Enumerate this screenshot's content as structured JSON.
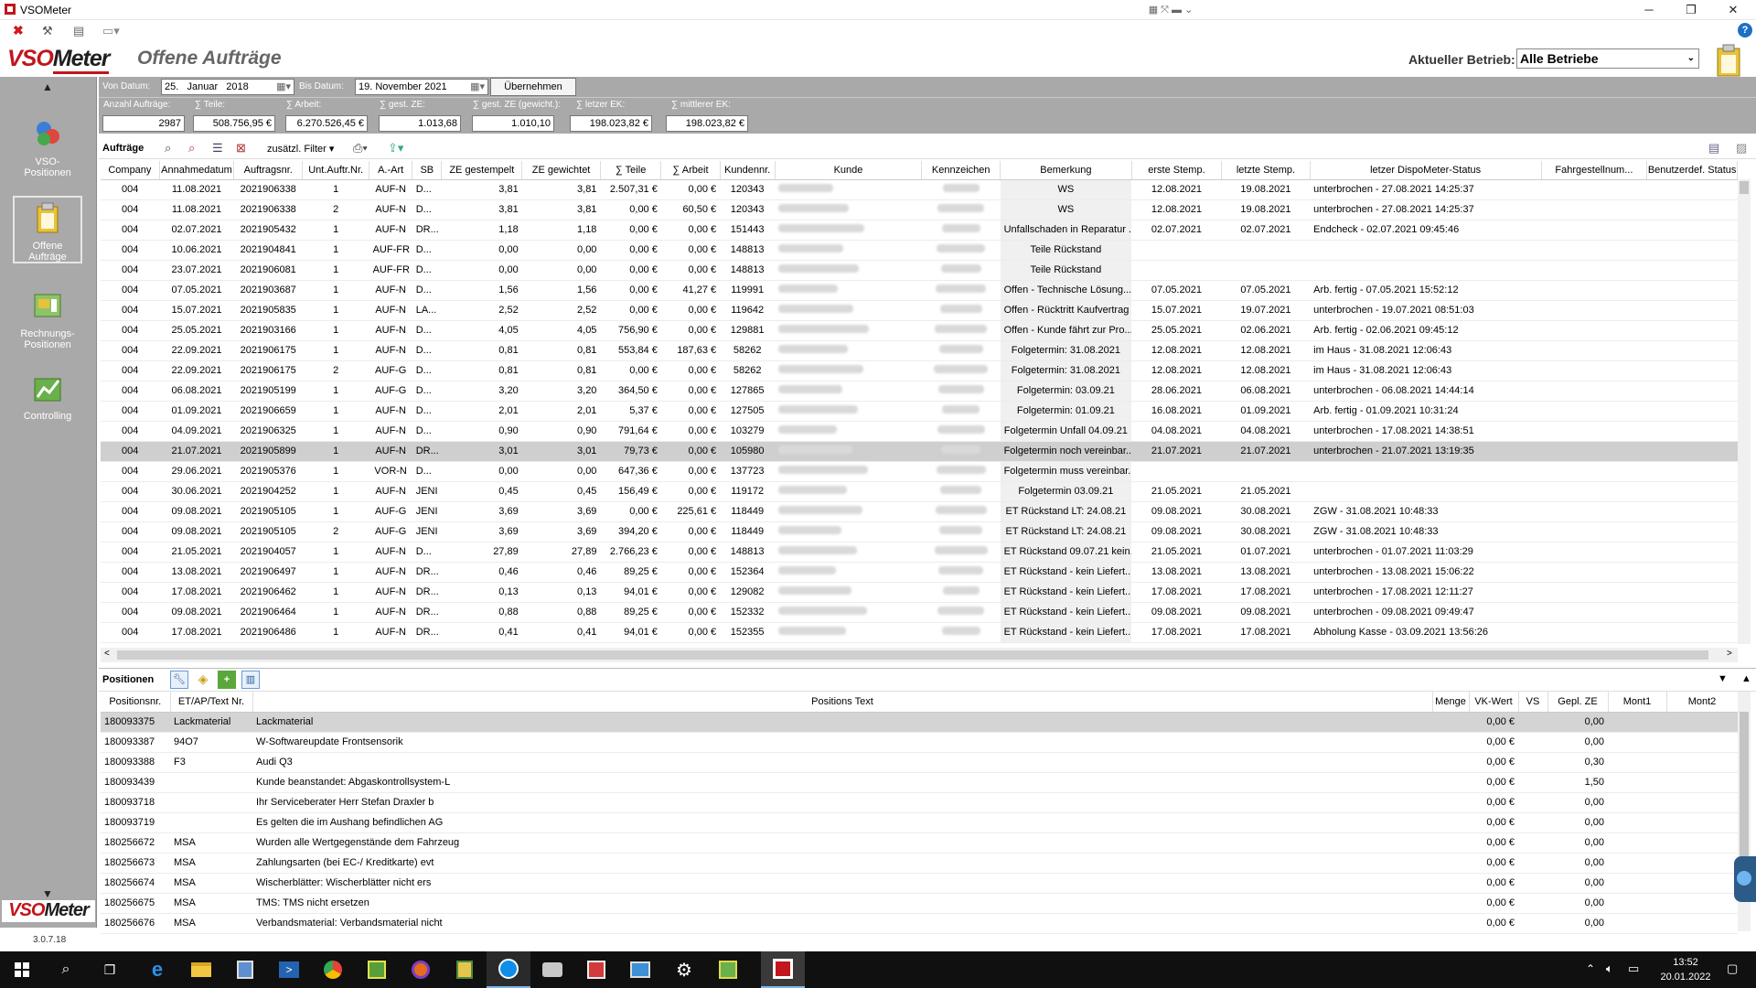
{
  "window": {
    "title": "VSOMeter"
  },
  "header": {
    "logo_left": "VSO",
    "logo_right": "Meter",
    "page_title": "Offene Aufträge",
    "betrieb_label": "Aktueller Betrieb:",
    "betrieb_value": "Alle Betriebe"
  },
  "sidebar": {
    "items": [
      {
        "label": "VSO-Positionen",
        "icon": "vso-positions-icon"
      },
      {
        "label": "Offene Aufträge",
        "icon": "clipboard-icon"
      },
      {
        "label": "Rechnungs-Positionen",
        "icon": "invoice-icon"
      },
      {
        "label": "Controlling",
        "icon": "chart-icon"
      }
    ],
    "footer_logo_left": "VSO",
    "footer_logo_right": "Meter",
    "version": "3.0.7.18"
  },
  "filter": {
    "von_label": "Von Datum:",
    "von_day": "25.",
    "von_month": "Januar",
    "von_year": "2018",
    "bis_label": "Bis Datum:",
    "bis_value": "19. November  2021",
    "apply_label": "Übernehmen"
  },
  "summary": {
    "anzahl_label": "Anzahl Aufträge:",
    "anzahl_value": "2987",
    "teile_label": "∑ Teile:",
    "teile_value": "508.756,95 €",
    "arbeit_label": "∑ Arbeit:",
    "arbeit_value": "6.270.526,45 €",
    "gest_label": "∑ gest. ZE:",
    "gest_value": "1.013,68",
    "gewicht_label": "∑ gest. ZE (gewicht.):",
    "gewicht_value": "1.010,10",
    "letzter_label": "∑ letzer EK:",
    "letzter_value": "198.023,82 €",
    "mittlerer_label": "∑ mittlerer EK:",
    "mittlerer_value": "198.023,82 €"
  },
  "orders_toolbar": {
    "label": "Aufträge",
    "filter_label": "zusätzl. Filter"
  },
  "orders": {
    "columns": [
      "Company",
      "Annahmedatum",
      "Auftragsnr.",
      "Unt.Auftr.Nr.",
      "A.-Art",
      "SB",
      "ZE gestempelt",
      "ZE gewichtet",
      "∑ Teile",
      "∑ Arbeit",
      "Kundennr.",
      "Kunde",
      "Kennzeichen",
      "Bemerkung",
      "erste Stemp.",
      "letzte Stemp.",
      "letzer DispoMeter-Status",
      "Fahrgestellnum...",
      "Benutzerdef. Status"
    ],
    "rows": [
      [
        "004",
        "11.08.2021",
        "2021906338",
        "1",
        "AUF-N",
        "D...",
        "3,81",
        "3,81",
        "2.507,31 €",
        "0,00 €",
        "120343",
        "",
        "",
        "WS",
        "12.08.2021",
        "19.08.2021",
        "unterbrochen - 27.08.2021 14:25:37"
      ],
      [
        "004",
        "11.08.2021",
        "2021906338",
        "2",
        "AUF-N",
        "D...",
        "3,81",
        "3,81",
        "0,00 €",
        "60,50 €",
        "120343",
        "",
        "",
        "WS",
        "12.08.2021",
        "19.08.2021",
        "unterbrochen - 27.08.2021 14:25:37"
      ],
      [
        "004",
        "02.07.2021",
        "2021905432",
        "1",
        "AUF-N",
        "DR...",
        "1,18",
        "1,18",
        "0,00 €",
        "0,00 €",
        "151443",
        "",
        "",
        "Unfallschaden in Reparatur ...",
        "02.07.2021",
        "02.07.2021",
        "Endcheck - 02.07.2021 09:45:46"
      ],
      [
        "004",
        "10.06.2021",
        "2021904841",
        "1",
        "AUF-FR",
        "D...",
        "0,00",
        "0,00",
        "0,00 €",
        "0,00 €",
        "148813",
        "",
        "",
        "Teile Rückstand",
        "",
        "",
        ""
      ],
      [
        "004",
        "23.07.2021",
        "2021906081",
        "1",
        "AUF-FR",
        "D...",
        "0,00",
        "0,00",
        "0,00 €",
        "0,00 €",
        "148813",
        "",
        "",
        "Teile Rückstand",
        "",
        "",
        ""
      ],
      [
        "004",
        "07.05.2021",
        "2021903687",
        "1",
        "AUF-N",
        "D...",
        "1,56",
        "1,56",
        "0,00 €",
        "41,27 €",
        "119991",
        "",
        "",
        "Offen - Technische Lösung...",
        "07.05.2021",
        "07.05.2021",
        "Arb. fertig - 07.05.2021 15:52:12"
      ],
      [
        "004",
        "15.07.2021",
        "2021905835",
        "1",
        "AUF-N",
        "LA...",
        "2,52",
        "2,52",
        "0,00 €",
        "0,00 €",
        "119642",
        "",
        "",
        "Offen - Rücktritt Kaufvertrag",
        "15.07.2021",
        "19.07.2021",
        "unterbrochen - 19.07.2021 08:51:03"
      ],
      [
        "004",
        "25.05.2021",
        "2021903166",
        "1",
        "AUF-N",
        "D...",
        "4,05",
        "4,05",
        "756,90 €",
        "0,00 €",
        "129881",
        "",
        "",
        "Offen - Kunde fährt zur Pro...",
        "25.05.2021",
        "02.06.2021",
        "Arb. fertig - 02.06.2021 09:45:12"
      ],
      [
        "004",
        "22.09.2021",
        "2021906175",
        "1",
        "AUF-N",
        "D...",
        "0,81",
        "0,81",
        "553,84 €",
        "187,63 €",
        "58262",
        "",
        "",
        "Folgetermin: 31.08.2021",
        "12.08.2021",
        "12.08.2021",
        "im Haus - 31.08.2021 12:06:43"
      ],
      [
        "004",
        "22.09.2021",
        "2021906175",
        "2",
        "AUF-G",
        "D...",
        "0,81",
        "0,81",
        "0,00 €",
        "0,00 €",
        "58262",
        "",
        "",
        "Folgetermin: 31.08.2021",
        "12.08.2021",
        "12.08.2021",
        "im Haus - 31.08.2021 12:06:43"
      ],
      [
        "004",
        "06.08.2021",
        "2021905199",
        "1",
        "AUF-G",
        "D...",
        "3,20",
        "3,20",
        "364,50 €",
        "0,00 €",
        "127865",
        "",
        "",
        "Folgetermin: 03.09.21",
        "28.06.2021",
        "06.08.2021",
        "unterbrochen - 06.08.2021 14:44:14"
      ],
      [
        "004",
        "01.09.2021",
        "2021906659",
        "1",
        "AUF-N",
        "D...",
        "2,01",
        "2,01",
        "5,37 €",
        "0,00 €",
        "127505",
        "",
        "",
        "Folgetermin: 01.09.21",
        "16.08.2021",
        "01.09.2021",
        "Arb. fertig - 01.09.2021 10:31:24"
      ],
      [
        "004",
        "04.09.2021",
        "2021906325",
        "1",
        "AUF-N",
        "D...",
        "0,90",
        "0,90",
        "791,64 €",
        "0,00 €",
        "103279",
        "",
        "",
        "Folgetermin Unfall 04.09.21",
        "04.08.2021",
        "04.08.2021",
        "unterbrochen - 17.08.2021 14:38:51"
      ],
      [
        "004",
        "21.07.2021",
        "2021905899",
        "1",
        "AUF-N",
        "DR...",
        "3,01",
        "3,01",
        "79,73 €",
        "0,00 €",
        "105980",
        "",
        "",
        "Folgetermin noch vereinbar...",
        "21.07.2021",
        "21.07.2021",
        "unterbrochen - 21.07.2021 13:19:35"
      ],
      [
        "004",
        "29.06.2021",
        "2021905376",
        "1",
        "VOR-N",
        "D...",
        "0,00",
        "0,00",
        "647,36 €",
        "0,00 €",
        "137723",
        "",
        "",
        "Folgetermin muss vereinbar...",
        "",
        "",
        ""
      ],
      [
        "004",
        "30.06.2021",
        "2021904252",
        "1",
        "AUF-N",
        "JENI",
        "0,45",
        "0,45",
        "156,49 €",
        "0,00 €",
        "119172",
        "",
        "",
        "Folgetermin 03.09.21",
        "21.05.2021",
        "21.05.2021",
        ""
      ],
      [
        "004",
        "09.08.2021",
        "2021905105",
        "1",
        "AUF-G",
        "JENI",
        "3,69",
        "3,69",
        "0,00 €",
        "225,61 €",
        "118449",
        "",
        "",
        "ET Rückstand LT: 24.08.21",
        "09.08.2021",
        "30.08.2021",
        "ZGW - 31.08.2021 10:48:33"
      ],
      [
        "004",
        "09.08.2021",
        "2021905105",
        "2",
        "AUF-G",
        "JENI",
        "3,69",
        "3,69",
        "394,20 €",
        "0,00 €",
        "118449",
        "",
        "",
        "ET Rückstand LT: 24.08.21",
        "09.08.2021",
        "30.08.2021",
        "ZGW - 31.08.2021 10:48:33"
      ],
      [
        "004",
        "21.05.2021",
        "2021904057",
        "1",
        "AUF-N",
        "D...",
        "27,89",
        "27,89",
        "2.766,23 €",
        "0,00 €",
        "148813",
        "",
        "",
        "ET Rückstand 09.07.21 kein...",
        "21.05.2021",
        "01.07.2021",
        "unterbrochen - 01.07.2021 11:03:29"
      ],
      [
        "004",
        "13.08.2021",
        "2021906497",
        "1",
        "AUF-N",
        "DR...",
        "0,46",
        "0,46",
        "89,25 €",
        "0,00 €",
        "152364",
        "",
        "",
        "ET Rückstand - kein Liefert...",
        "13.08.2021",
        "13.08.2021",
        "unterbrochen - 13.08.2021 15:06:22"
      ],
      [
        "004",
        "17.08.2021",
        "2021906462",
        "1",
        "AUF-N",
        "DR...",
        "0,13",
        "0,13",
        "94,01 €",
        "0,00 €",
        "129082",
        "",
        "",
        "ET Rückstand - kein Liefert...",
        "17.08.2021",
        "17.08.2021",
        "unterbrochen - 17.08.2021 12:11:27"
      ],
      [
        "004",
        "09.08.2021",
        "2021906464",
        "1",
        "AUF-N",
        "DR...",
        "0,88",
        "0,88",
        "89,25 €",
        "0,00 €",
        "152332",
        "",
        "",
        "ET Rückstand - kein Liefert...",
        "09.08.2021",
        "09.08.2021",
        "unterbrochen - 09.08.2021 09:49:47"
      ],
      [
        "004",
        "17.08.2021",
        "2021906486",
        "1",
        "AUF-N",
        "DR...",
        "0,41",
        "0,41",
        "94,01 €",
        "0,00 €",
        "152355",
        "",
        "",
        "ET Rückstand - kein Liefert...",
        "17.08.2021",
        "17.08.2021",
        "Abholung Kasse - 03.09.2021 13:56:26"
      ]
    ]
  },
  "positions_toolbar": {
    "label": "Positionen"
  },
  "positions": {
    "columns": [
      "Positionsnr.",
      "ET/AP/Text Nr.",
      "Positions Text",
      "Menge",
      "VK-Wert",
      "VS",
      "Gepl. ZE",
      "Mont1",
      "Mont2"
    ],
    "rows": [
      [
        "180093375",
        "Lackmaterial",
        "Lackmaterial",
        "",
        "0,00 €",
        "",
        "0,00"
      ],
      [
        "180093387",
        "94O7",
        "W-Softwareupdate Frontsensorik",
        "",
        "0,00 €",
        "",
        "0,00"
      ],
      [
        "180093388",
        "F3",
        "Audi Q3",
        "",
        "0,00 €",
        "",
        "0,30"
      ],
      [
        "180093439",
        "",
        "Kunde beanstandet: Abgaskontrollsystem-L",
        "",
        "0,00 €",
        "",
        "1,50"
      ],
      [
        "180093718",
        "",
        "Ihr Serviceberater Herr Stefan Draxler b",
        "",
        "0,00 €",
        "",
        "0,00"
      ],
      [
        "180093719",
        "",
        "Es gelten die im Aushang befindlichen AG",
        "",
        "0,00 €",
        "",
        "0,00"
      ],
      [
        "180256672",
        "MSA",
        "Wurden alle Wertgegenstände dem Fahrzeug",
        "",
        "0,00 €",
        "",
        "0,00"
      ],
      [
        "180256673",
        "MSA",
        "Zahlungsarten (bei EC-/ Kreditkarte) evt",
        "",
        "0,00 €",
        "",
        "0,00"
      ],
      [
        "180256674",
        "MSA",
        "Wischerblätter: Wischerblätter nicht ers",
        "",
        "0,00 €",
        "",
        "0,00"
      ],
      [
        "180256675",
        "MSA",
        "TMS: TMS nicht ersetzen",
        "",
        "0,00 €",
        "",
        "0,00"
      ],
      [
        "180256676",
        "MSA",
        "Verbandsmaterial: Verbandsmaterial nicht",
        "",
        "0,00 €",
        "",
        "0,00"
      ]
    ]
  },
  "taskbar": {
    "time": "13:52",
    "date": "20.01.2022"
  },
  "colors": {
    "sidebar": "#a9a9a9",
    "selected_row": "#cfcfcf",
    "logo_red": "#c0161c",
    "taskbar": "#101010"
  }
}
